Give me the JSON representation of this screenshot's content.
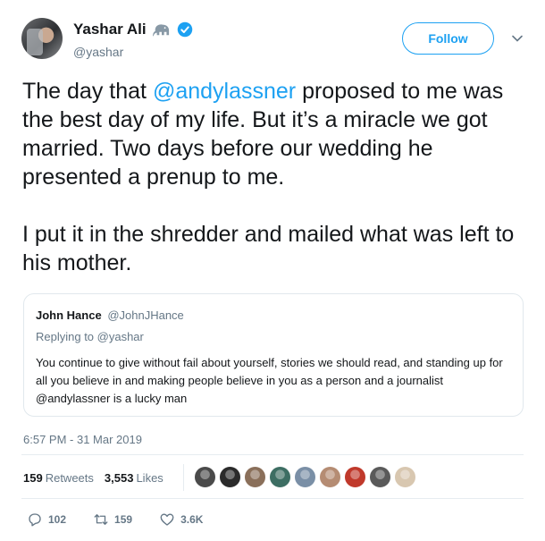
{
  "user": {
    "display_name": "Yashar Ali",
    "handle": "@yashar",
    "follow_label": "Follow"
  },
  "tweet": {
    "mention": "@andylassner",
    "line1_before": "The day that ",
    "line1_after": " proposed to me was the best day of my life. But it’s a miracle we got married. Two days before our wedding he presented a prenup to me.",
    "paragraph2": "I put it in the shredder and mailed what was left to his mother."
  },
  "quote": {
    "name": "John Hance",
    "handle": "@JohnJHance",
    "replying": "Replying to @yashar",
    "text": "You continue to give without fail about yourself, stories we should read, and standing up for all you believe in and making people believe in you as a person and a journalist @andylassner is a lucky man"
  },
  "timestamp": "6:57 PM - 31 Mar 2019",
  "stats": {
    "retweets_count": "159",
    "retweets_label": "Retweets",
    "likes_count": "3,553",
    "likes_label": "Likes"
  },
  "liker_colors": [
    "#4a4a4a",
    "#2b2b2b",
    "#8a6f5a",
    "#3d6e63",
    "#7a8fa6",
    "#b58c73",
    "#c0392b",
    "#5a5a5a",
    "#d8c7b0"
  ],
  "actions": {
    "replies": "102",
    "retweets": "159",
    "likes": "3.6K"
  },
  "colors": {
    "accent": "#1da1f2",
    "secondary_text": "#657786"
  }
}
